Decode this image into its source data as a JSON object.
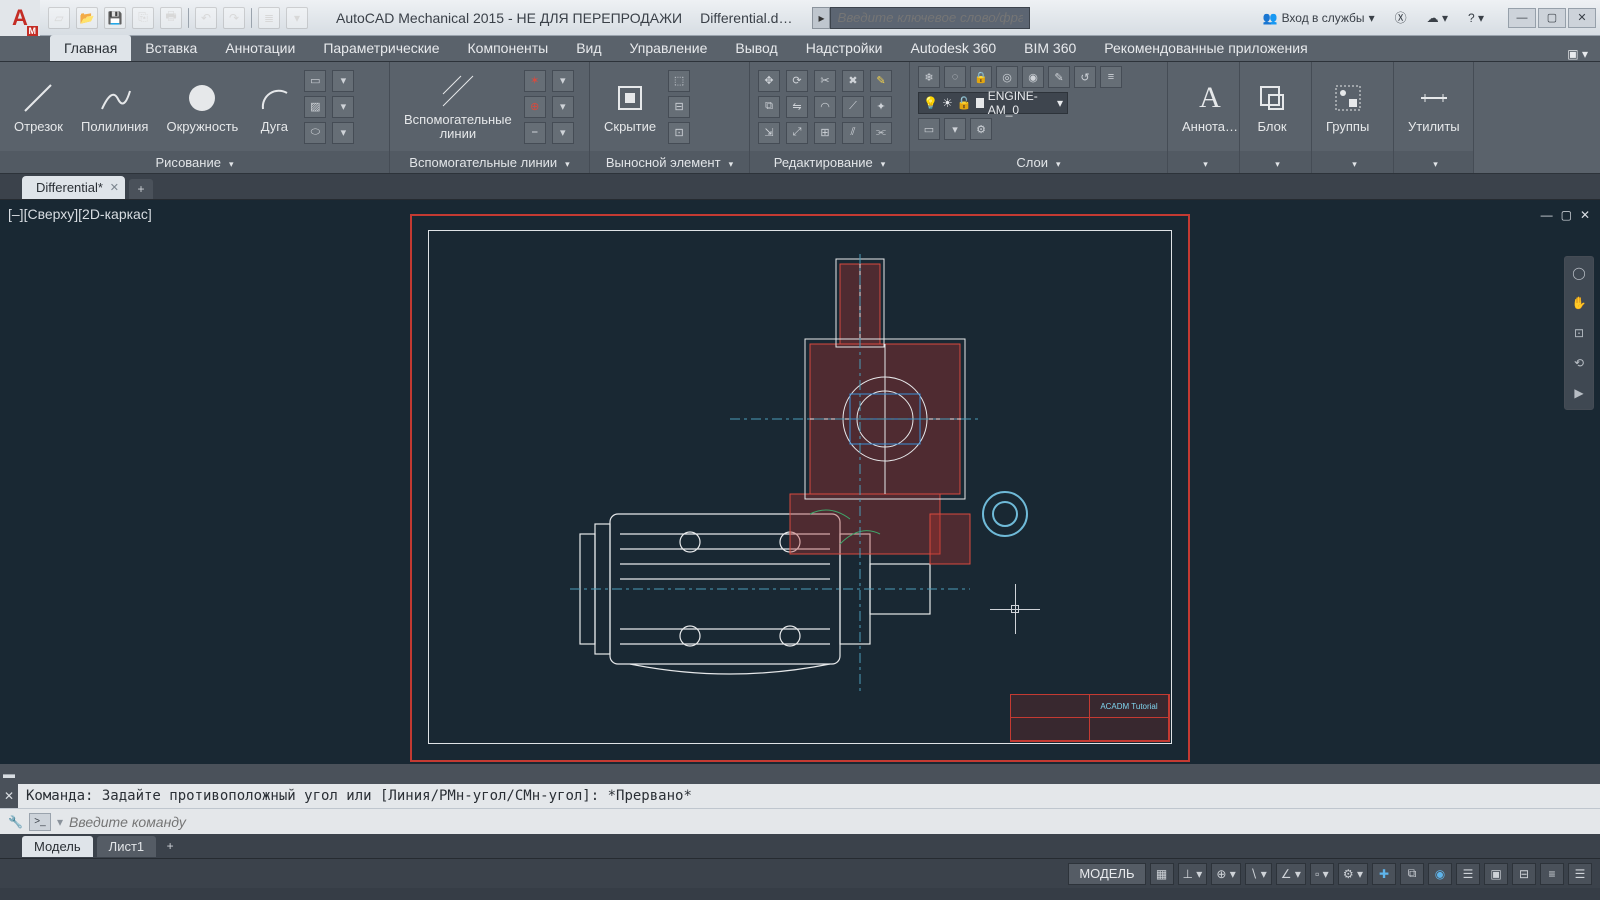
{
  "titlebar": {
    "app_title": "AutoCAD Mechanical 2015 - НЕ ДЛЯ ПЕРЕПРОДАЖИ",
    "doc_title": "Differential.d…",
    "search_placeholder": "Введите ключевое слово/фразу",
    "signin": "Вход в службы"
  },
  "ribbon_tabs": [
    "Главная",
    "Вставка",
    "Аннотации",
    "Параметрические",
    "Компоненты",
    "Вид",
    "Управление",
    "Вывод",
    "Надстройки",
    "Autodesk 360",
    "BIM 360",
    "Рекомендованные приложения"
  ],
  "ribbon": {
    "draw": {
      "title": "Рисование",
      "line": "Отрезок",
      "polyline": "Полилиния",
      "circle": "Окружность",
      "arc": "Дуга"
    },
    "aux": {
      "title": "Вспомогательные линии",
      "btn": "Вспомогательные\nлинии"
    },
    "dim": {
      "title": "Выносной элемент",
      "hide": "Скрытие"
    },
    "edit": {
      "title": "Редактирование"
    },
    "layers": {
      "title": "Слои",
      "current": "ENGINE-AM_0"
    },
    "annot": {
      "title": "Аннота…"
    },
    "block": {
      "title": "Блок"
    },
    "groups": {
      "title": "Группы"
    },
    "utils": {
      "title": "Утилиты"
    }
  },
  "filetab": {
    "name": "Differential*"
  },
  "viewport": {
    "label": "[–][Сверху][2D-каркас]"
  },
  "titleblock_text": "ACADM Tutorial",
  "command": {
    "history": "Команда: Задайте противоположный угол или [Линия/РМн-угол/СМн-угол]: *Прервано*",
    "placeholder": "Введите команду"
  },
  "bottom_tabs": {
    "model": "Модель",
    "sheet": "Лист1"
  },
  "status": {
    "space": "МОДЕЛЬ"
  }
}
